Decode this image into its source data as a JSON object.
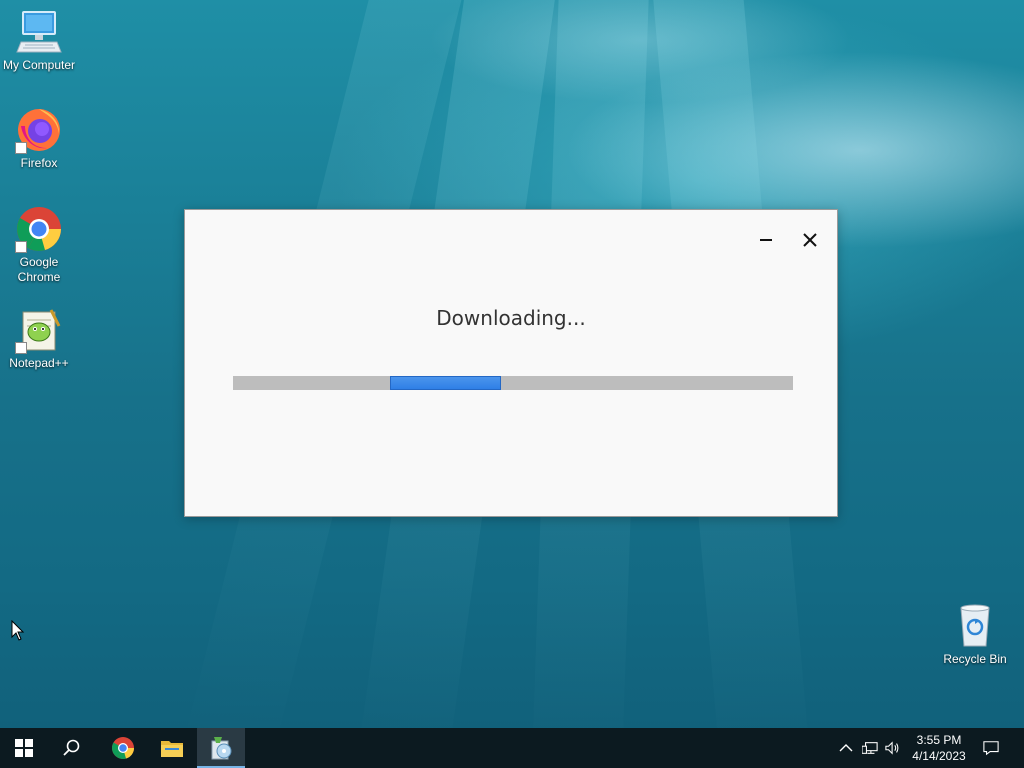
{
  "desktop": {
    "icons": [
      {
        "label": "My Computer",
        "icon": "computer-icon"
      },
      {
        "label": "Firefox",
        "icon": "firefox-icon"
      },
      {
        "label": "Google Chrome",
        "icon": "chrome-icon"
      },
      {
        "label": "Notepad++",
        "icon": "notepad-plus-plus-icon"
      },
      {
        "label": "Recycle Bin",
        "icon": "recycle-bin-icon"
      }
    ]
  },
  "dialog": {
    "title": "Downloading...",
    "minimize_icon": "minimize-icon",
    "close_icon": "close-icon",
    "progress": {
      "state": "indeterminate",
      "segment_start_fraction": 0.28,
      "segment_end_fraction": 0.478
    }
  },
  "taskbar": {
    "start_icon": "windows-start-icon",
    "search_icon": "search-icon",
    "pinned": [
      {
        "name": "chrome",
        "icon": "chrome-icon",
        "active": false
      },
      {
        "name": "file-explorer",
        "icon": "folder-icon",
        "active": false
      },
      {
        "name": "installer",
        "icon": "installer-icon",
        "active": true
      }
    ],
    "tray": {
      "icons": [
        "chevron-up-icon",
        "network-icon",
        "volume-icon"
      ],
      "time": "3:55 PM",
      "date": "4/14/2023",
      "notification_icon": "notification-icon"
    }
  },
  "colors": {
    "taskbar_bg": "#0c1a20",
    "progress_track": "#bdbdbd",
    "progress_fill": "#2f7fe6",
    "dialog_bg": "#f9f9f9"
  }
}
